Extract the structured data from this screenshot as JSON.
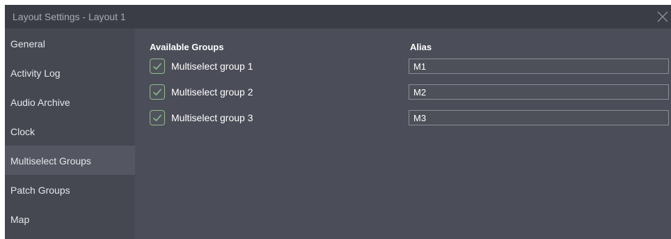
{
  "window": {
    "title": "Layout Settings - Layout 1",
    "close_icon": "close-icon"
  },
  "sidebar": {
    "items": [
      {
        "label": "General",
        "active": false
      },
      {
        "label": "Activity Log",
        "active": false
      },
      {
        "label": "Audio Archive",
        "active": false
      },
      {
        "label": "Clock",
        "active": false
      },
      {
        "label": "Multiselect Groups",
        "active": true
      },
      {
        "label": "Patch Groups",
        "active": false
      },
      {
        "label": "Map",
        "active": false
      }
    ]
  },
  "main": {
    "available_groups_header": "Available Groups",
    "alias_header": "Alias",
    "groups": [
      {
        "name": "Multiselect group 1",
        "checked": true,
        "alias": "M1"
      },
      {
        "name": "Multiselect group 2",
        "checked": true,
        "alias": "M2"
      },
      {
        "name": "Multiselect group 3",
        "checked": true,
        "alias": "M3"
      }
    ]
  },
  "colors": {
    "titlebar": "#3b3d46",
    "sidebar": "#454751",
    "sidebar_active": "#545661",
    "panel": "#4b4d58",
    "check_accent": "#8fbc8f"
  }
}
